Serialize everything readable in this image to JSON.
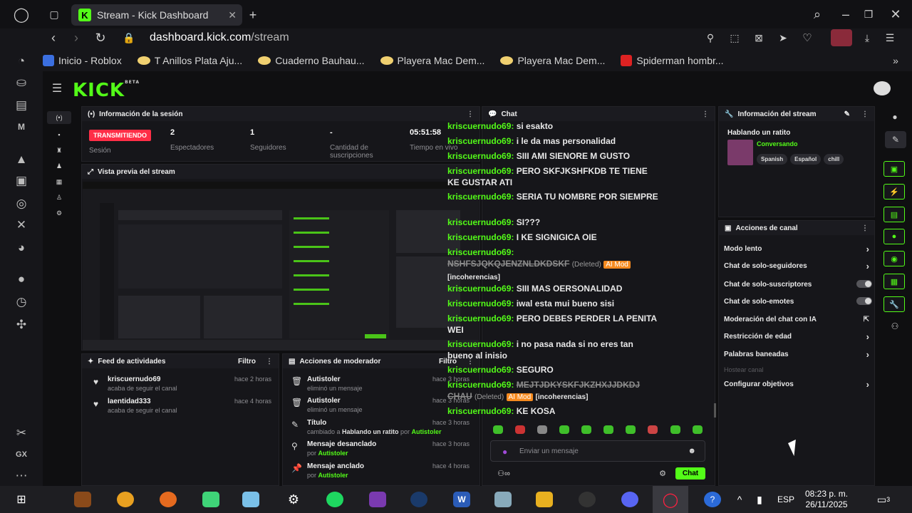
{
  "browser": {
    "tab_title": "Stream - Kick Dashboard",
    "url_domain": "dashboard.kick.com",
    "url_path": "/stream",
    "bookmarks": [
      {
        "label": "Inicio - Roblox",
        "icon": "roblox-icon"
      },
      {
        "label": "T Anillos Plata Aju...",
        "icon": "shop-icon"
      },
      {
        "label": "Cuaderno Bauhau...",
        "icon": "shop-icon"
      },
      {
        "label": "Playera Mac Dem...",
        "icon": "shop-icon"
      },
      {
        "label": "Playera Mac Dem...",
        "icon": "shop-icon"
      },
      {
        "label": "Spiderman hombr...",
        "icon": "spider-icon"
      }
    ]
  },
  "app": {
    "logo": "KICK",
    "logo_beta": "BETA"
  },
  "session": {
    "title": "Información de la sesión",
    "status": "TRANSMITIENDO",
    "status_label": "Sesión",
    "stats": [
      {
        "value": "2",
        "label": "Espectadores"
      },
      {
        "value": "1",
        "label": "Seguidores"
      },
      {
        "value": "-",
        "label": "Cantidad de suscripciones"
      },
      {
        "value": "05:51:58",
        "label": "Tiempo en vivo"
      }
    ]
  },
  "preview": {
    "title": "Vista previa del stream"
  },
  "feed": {
    "title": "Feed de actividades",
    "filter": "Filtro",
    "items": [
      {
        "name": "kriscuernudo69",
        "sub": "acaba de seguir el canal",
        "time": "hace 2 horas"
      },
      {
        "name": "laentidad333",
        "sub": "acaba de seguir el canal",
        "time": "hace 4 horas"
      }
    ]
  },
  "mod_actions": {
    "title": "Acciones de moderador",
    "filter": "Filtro",
    "items": [
      {
        "name": "Autistoler",
        "sub": "eliminó un mensaje",
        "time": "hace 3 horas"
      },
      {
        "name": "Autistoler",
        "sub": "eliminó un mensaje",
        "time": "hace 3 horas"
      },
      {
        "name": "Título",
        "sub_a": "cambiado a ",
        "sub_b": "Hablando un ratito",
        "sub_c": " por ",
        "sub_d": "Autistoler",
        "time": "hace 3 horas"
      },
      {
        "name": "Mensaje desanclado",
        "sub_a": "por ",
        "sub_d": "Autistoler",
        "time": "hace 3 horas"
      },
      {
        "name": "Mensaje anclado",
        "sub_a": "por ",
        "sub_d": "Autistoler",
        "time": "hace 4 horas"
      }
    ]
  },
  "chat": {
    "title": "Chat",
    "user": "kriscuernudo69:",
    "messages": [
      "si esakto",
      "i le da mas personalidad",
      "SIII AMI SIENORE M GUSTO",
      "PERO SKFJKSHFKDB TE TIENE KE GUSTAR ATI",
      "SERIA TU NOMBRE POR SIEMPRE",
      "SI???",
      "I KE SIGNIGICA OIE",
      "SIII MAS OERSONALIDAD",
      "iwal esta mui bueno sisi",
      "PERO DEBES PERDER LA PENITA WEI",
      "i no pasa nada si no eres tan bueno al inisio",
      "SEGURO",
      "KE KOSA"
    ],
    "deleted_1": "NSHFSJQKQJENZNLDKDSKF",
    "deleted_2": "MEJTJDKYSKFJKZHXJJDKDJ CHAU",
    "deleted_tag": "(Deleted)",
    "ai_mod": "AI Mod",
    "reason": "[incoherencias]",
    "input_placeholder": "Enviar un mensaje",
    "send": "Chat"
  },
  "stream_info": {
    "title": "Información del stream",
    "stream_title": "Hablando un ratito",
    "category": "Conversando",
    "tags": [
      "Spanish",
      "Español",
      "chill"
    ]
  },
  "channel_actions": {
    "title": "Acciones de canal",
    "items": [
      {
        "label": "Modo lento",
        "kind": "chevron"
      },
      {
        "label": "Chat de solo-seguidores",
        "kind": "chevron"
      },
      {
        "label": "Chat de solo-suscriptores",
        "kind": "toggle"
      },
      {
        "label": "Chat de solo-emotes",
        "kind": "toggle"
      },
      {
        "label": "Moderación del chat con IA",
        "kind": "external"
      },
      {
        "label": "Restricción de edad",
        "kind": "chevron"
      },
      {
        "label": "Palabras baneadas",
        "kind": "chevron"
      },
      {
        "label": "Hostear canal",
        "kind": "disabled"
      },
      {
        "label": "Configurar objetivos",
        "kind": "chevron"
      }
    ]
  },
  "taskbar": {
    "language": "ESP",
    "time": "08:23 p. m.",
    "date": "26/11/2025",
    "notifications": "3"
  },
  "colors": {
    "kick_green": "#53fc18",
    "live_red": "#ff2e47",
    "ai_mod_orange": "#f58a1f"
  }
}
